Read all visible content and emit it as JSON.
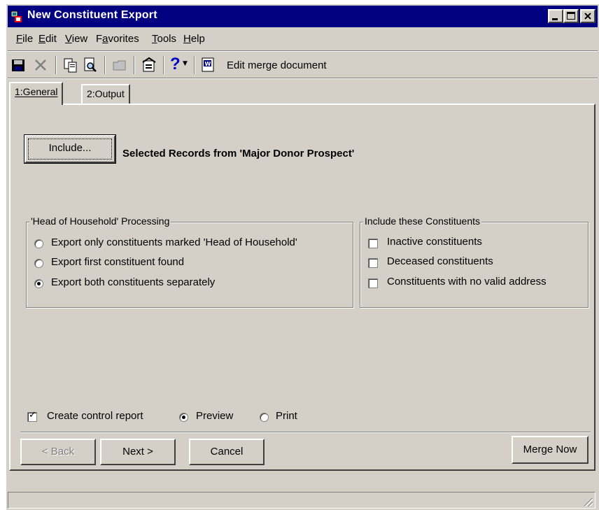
{
  "window": {
    "title": "New Constituent Export",
    "controls": [
      "minimize",
      "maximize",
      "close"
    ]
  },
  "menubar": {
    "items": [
      {
        "label": "File",
        "mnemonic": "F"
      },
      {
        "label": "Edit",
        "mnemonic": "E"
      },
      {
        "label": "View",
        "mnemonic": "V"
      },
      {
        "label": "Favorites",
        "mnemonic": "a"
      },
      {
        "label": "Tools",
        "mnemonic": "T"
      },
      {
        "label": "Help",
        "mnemonic": "H"
      }
    ]
  },
  "toolbar": {
    "icons": [
      "save-icon",
      "delete-icon",
      "copy-icon",
      "print-preview-icon",
      "folder-icon",
      "properties-icon",
      "help-icon",
      "word-icon"
    ],
    "edit_merge_label": "Edit merge document"
  },
  "tabs": [
    {
      "label": "1:General",
      "active": true
    },
    {
      "label": "2:Output",
      "active": false
    }
  ],
  "general": {
    "include_button": "Include...",
    "selected_records": "Selected Records from 'Major Donor Prospect'",
    "hoh_group": {
      "title": "'Head of Household' Processing",
      "options": [
        {
          "label": "Export only constituents marked 'Head of Household'",
          "selected": false
        },
        {
          "label": "Export first constituent found",
          "selected": false
        },
        {
          "label": "Export both constituents separately",
          "selected": true
        }
      ]
    },
    "include_group": {
      "title": "Include these Constituents",
      "options": [
        {
          "label": "Inactive constituents",
          "checked": false
        },
        {
          "label": "Deceased constituents",
          "checked": false
        },
        {
          "label": "Constituents with no valid address",
          "checked": false
        }
      ]
    },
    "control_report": {
      "label": "Create control report",
      "checked": true,
      "preview_label": "Preview",
      "print_label": "Print",
      "output": "Preview"
    }
  },
  "buttons": {
    "back": "< Back",
    "next": "Next >",
    "cancel": "Cancel",
    "merge_now": "Merge Now"
  },
  "colors": {
    "titlebar": "#000080",
    "face": "#d4d0c8"
  }
}
